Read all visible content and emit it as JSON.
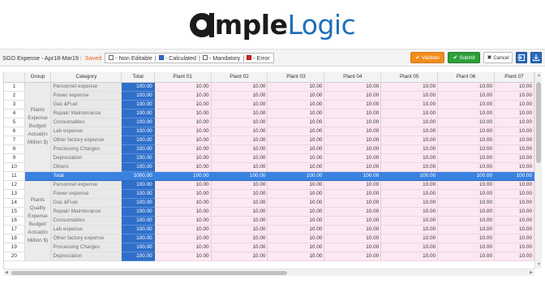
{
  "logo": {
    "part_bold": "mple",
    "part_colored": "Logic"
  },
  "toolbar": {
    "title": "SGO Expense - Apr18-Mar19 :",
    "status": "Saved",
    "legend": {
      "non_editable": "- Non Editable",
      "calculated": "- Calculated",
      "mandatory": "- Mandatory",
      "error": "- Error",
      "separator": "|"
    },
    "validate_label": "Validate",
    "submit_label": "Submit",
    "cancel_label": "Cancel",
    "icons": {
      "validate": "check-icon",
      "submit": "check-icon",
      "cancel": "close-icon",
      "export": "export-icon",
      "download": "download-icon"
    }
  },
  "colors": {
    "calculated": "#2f6fca",
    "editable": "#fce8f2",
    "total_row": "#3a82e0",
    "validate": "#f08c1c",
    "submit": "#2e9f3a",
    "saved_status": "#e8601c"
  },
  "grid": {
    "columns": [
      "",
      "Group",
      "Category",
      "Total",
      "Plant 01",
      "Plant 02",
      "Plant 03",
      "Plant 04",
      "Plant 05",
      "Plant 06",
      "Plant 07"
    ],
    "groups": [
      {
        "label": "Plants Expense Budget/ Actual(in Million $)"
      },
      {
        "label": "Plants Quality Expense Budget/ Actual(in Million $)"
      }
    ],
    "rows": [
      {
        "n": "1",
        "cat": "Personnel expense",
        "total": "100.00",
        "plants": [
          "10.00",
          "10.00",
          "10.00",
          "10.00",
          "10.00",
          "10.00",
          "10.00"
        ]
      },
      {
        "n": "2",
        "cat": "Power expense",
        "total": "100.00",
        "plants": [
          "10.00",
          "10.00",
          "10.00",
          "10.00",
          "10.00",
          "10.00",
          "10.00"
        ]
      },
      {
        "n": "3",
        "cat": "Gas &Fuel",
        "total": "100.00",
        "plants": [
          "10.00",
          "10.00",
          "10.00",
          "10.00",
          "10.00",
          "10.00",
          "10.00"
        ]
      },
      {
        "n": "4",
        "cat": "Repair/ Maintenance",
        "total": "100.00",
        "plants": [
          "10.00",
          "10.00",
          "10.00",
          "10.00",
          "10.00",
          "10.00",
          "10.00"
        ]
      },
      {
        "n": "5",
        "cat": "Consumables",
        "total": "100.00",
        "plants": [
          "10.00",
          "10.00",
          "10.00",
          "10.00",
          "10.00",
          "10.00",
          "10.00"
        ]
      },
      {
        "n": "6",
        "cat": "Lab expense",
        "total": "100.00",
        "plants": [
          "10.00",
          "10.00",
          "10.00",
          "10.00",
          "10.00",
          "10.00",
          "10.00"
        ]
      },
      {
        "n": "7",
        "cat": "Other factory expense",
        "total": "100.00",
        "plants": [
          "10.00",
          "10.00",
          "10.00",
          "10.00",
          "10.00",
          "10.00",
          "10.00"
        ]
      },
      {
        "n": "8",
        "cat": "Processing Charges",
        "total": "100.00",
        "plants": [
          "10.00",
          "10.00",
          "10.00",
          "10.00",
          "10.00",
          "10.00",
          "10.00"
        ]
      },
      {
        "n": "9",
        "cat": "Depreciation",
        "total": "100.00",
        "plants": [
          "10.00",
          "10.00",
          "10.00",
          "10.00",
          "10.00",
          "10.00",
          "10.00"
        ]
      },
      {
        "n": "10",
        "cat": "Others",
        "total": "100.00",
        "plants": [
          "10.00",
          "10.00",
          "10.00",
          "10.00",
          "10.00",
          "10.00",
          "10.00"
        ]
      },
      {
        "n": "11",
        "cat": "Total",
        "total": "1000.00",
        "plants": [
          "100.00",
          "100.00",
          "100.00",
          "100.00",
          "100.00",
          "100.00",
          "100.00"
        ],
        "is_total": true
      },
      {
        "n": "12",
        "cat": "Personnel expense",
        "total": "100.00",
        "plants": [
          "10.00",
          "10.00",
          "10.00",
          "10.00",
          "10.00",
          "10.00",
          "10.00"
        ]
      },
      {
        "n": "13",
        "cat": "Power expense",
        "total": "100.00",
        "plants": [
          "10.00",
          "10.00",
          "10.00",
          "10.00",
          "10.00",
          "10.00",
          "10.00"
        ]
      },
      {
        "n": "14",
        "cat": "Gas &Fuel",
        "total": "100.00",
        "plants": [
          "10.00",
          "10.00",
          "10.00",
          "10.00",
          "10.00",
          "10.00",
          "10.00"
        ]
      },
      {
        "n": "15",
        "cat": "Repair/ Maintenance",
        "total": "100.00",
        "plants": [
          "10.00",
          "10.00",
          "10.00",
          "10.00",
          "10.00",
          "10.00",
          "10.00"
        ]
      },
      {
        "n": "16",
        "cat": "Consumables",
        "total": "100.00",
        "plants": [
          "10.00",
          "10.00",
          "10.00",
          "10.00",
          "10.00",
          "10.00",
          "10.00"
        ]
      },
      {
        "n": "17",
        "cat": "Lab expense",
        "total": "100.00",
        "plants": [
          "10.00",
          "10.00",
          "10.00",
          "10.00",
          "10.00",
          "10.00",
          "10.00"
        ]
      },
      {
        "n": "18",
        "cat": "Other factory expense",
        "total": "100.00",
        "plants": [
          "10.00",
          "10.00",
          "10.00",
          "10.00",
          "10.00",
          "10.00",
          "10.00"
        ]
      },
      {
        "n": "19",
        "cat": "Processing Charges",
        "total": "100.00",
        "plants": [
          "10.00",
          "10.00",
          "10.00",
          "10.00",
          "10.00",
          "10.00",
          "10.00"
        ]
      },
      {
        "n": "20",
        "cat": "Depreciation",
        "total": "100.00",
        "plants": [
          "10.00",
          "10.00",
          "10.00",
          "10.00",
          "10.00",
          "10.00",
          "10.00"
        ]
      }
    ]
  }
}
